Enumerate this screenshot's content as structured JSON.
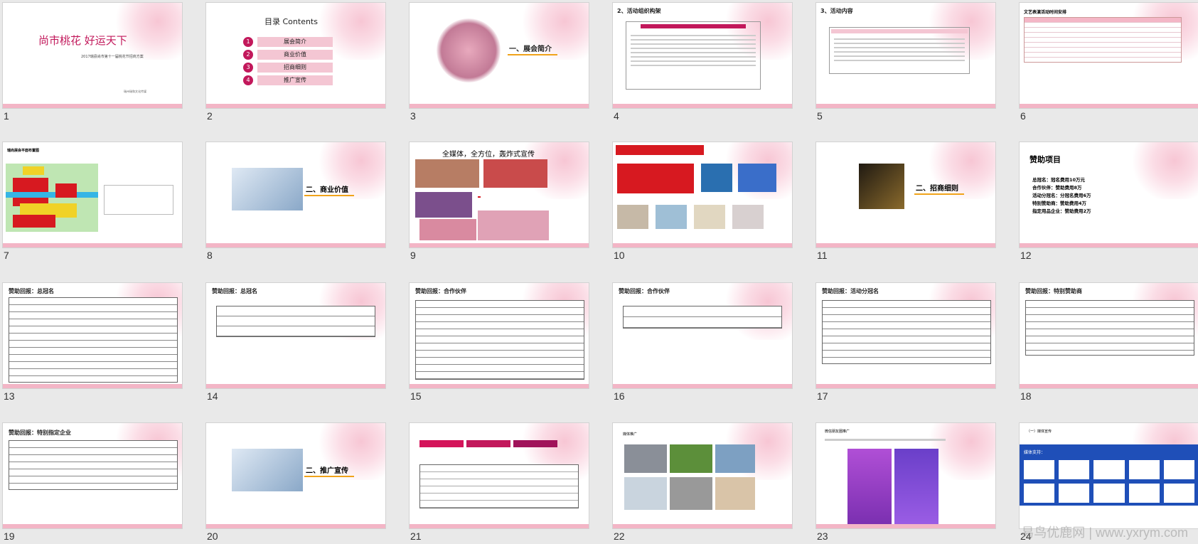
{
  "slides": [
    {
      "num": "1",
      "title": "尚市桃花  好运天下",
      "subtitle": "2017瑞县尚市第十一届桃花节招商方案",
      "footer": "瑞州瑞和文化传媒"
    },
    {
      "num": "2",
      "title": "目录  Contents",
      "items": [
        "展会简介",
        "商业价值",
        "招商细则",
        "推广宣传"
      ],
      "item_nums": [
        "1",
        "2",
        "3",
        "4"
      ]
    },
    {
      "num": "3",
      "heading": "一、展会简介"
    },
    {
      "num": "4",
      "heading": "2、活动组织构架"
    },
    {
      "num": "5",
      "heading": "3、活动内容"
    },
    {
      "num": "6",
      "heading": "文艺表演活动时间安排"
    },
    {
      "num": "7",
      "heading": "瑞尚展会平面布置图"
    },
    {
      "num": "8",
      "heading": "二、商业价值"
    },
    {
      "num": "9",
      "heading": "全媒体，全方位，轰炸式宣传"
    },
    {
      "num": "10",
      "heading": ""
    },
    {
      "num": "11",
      "heading": "二、招商细则"
    },
    {
      "num": "12",
      "heading": "赞助项目",
      "items": [
        "总冠名：冠名费用10万元",
        "合作伙伴：赞助费用8万",
        "活动分冠名：分冠名费用6万",
        "特别赞助商：赞助费用4万",
        "指定用品企业：赞助费用2万"
      ]
    },
    {
      "num": "13",
      "heading": "赞助回报：总冠名"
    },
    {
      "num": "14",
      "heading": "赞助回报：总冠名"
    },
    {
      "num": "15",
      "heading": "赞助回报：合作伙伴"
    },
    {
      "num": "16",
      "heading": "赞助回报：合作伙伴"
    },
    {
      "num": "17",
      "heading": "赞助回报：活动分冠名"
    },
    {
      "num": "18",
      "heading": "赞助回报：特别赞助商"
    },
    {
      "num": "19",
      "heading": "赞助回报：特别指定企业"
    },
    {
      "num": "20",
      "heading": "二、推广宣传"
    },
    {
      "num": "21",
      "heading": ""
    },
    {
      "num": "22",
      "heading": "媒体推广"
    },
    {
      "num": "23",
      "heading": "微信朋友圈推广"
    },
    {
      "num": "24",
      "heading": "（一）媒体宣传",
      "subheading": "媒体支持："
    }
  ],
  "watermark": "易鸟优鹿网 | www.yxrym.com"
}
